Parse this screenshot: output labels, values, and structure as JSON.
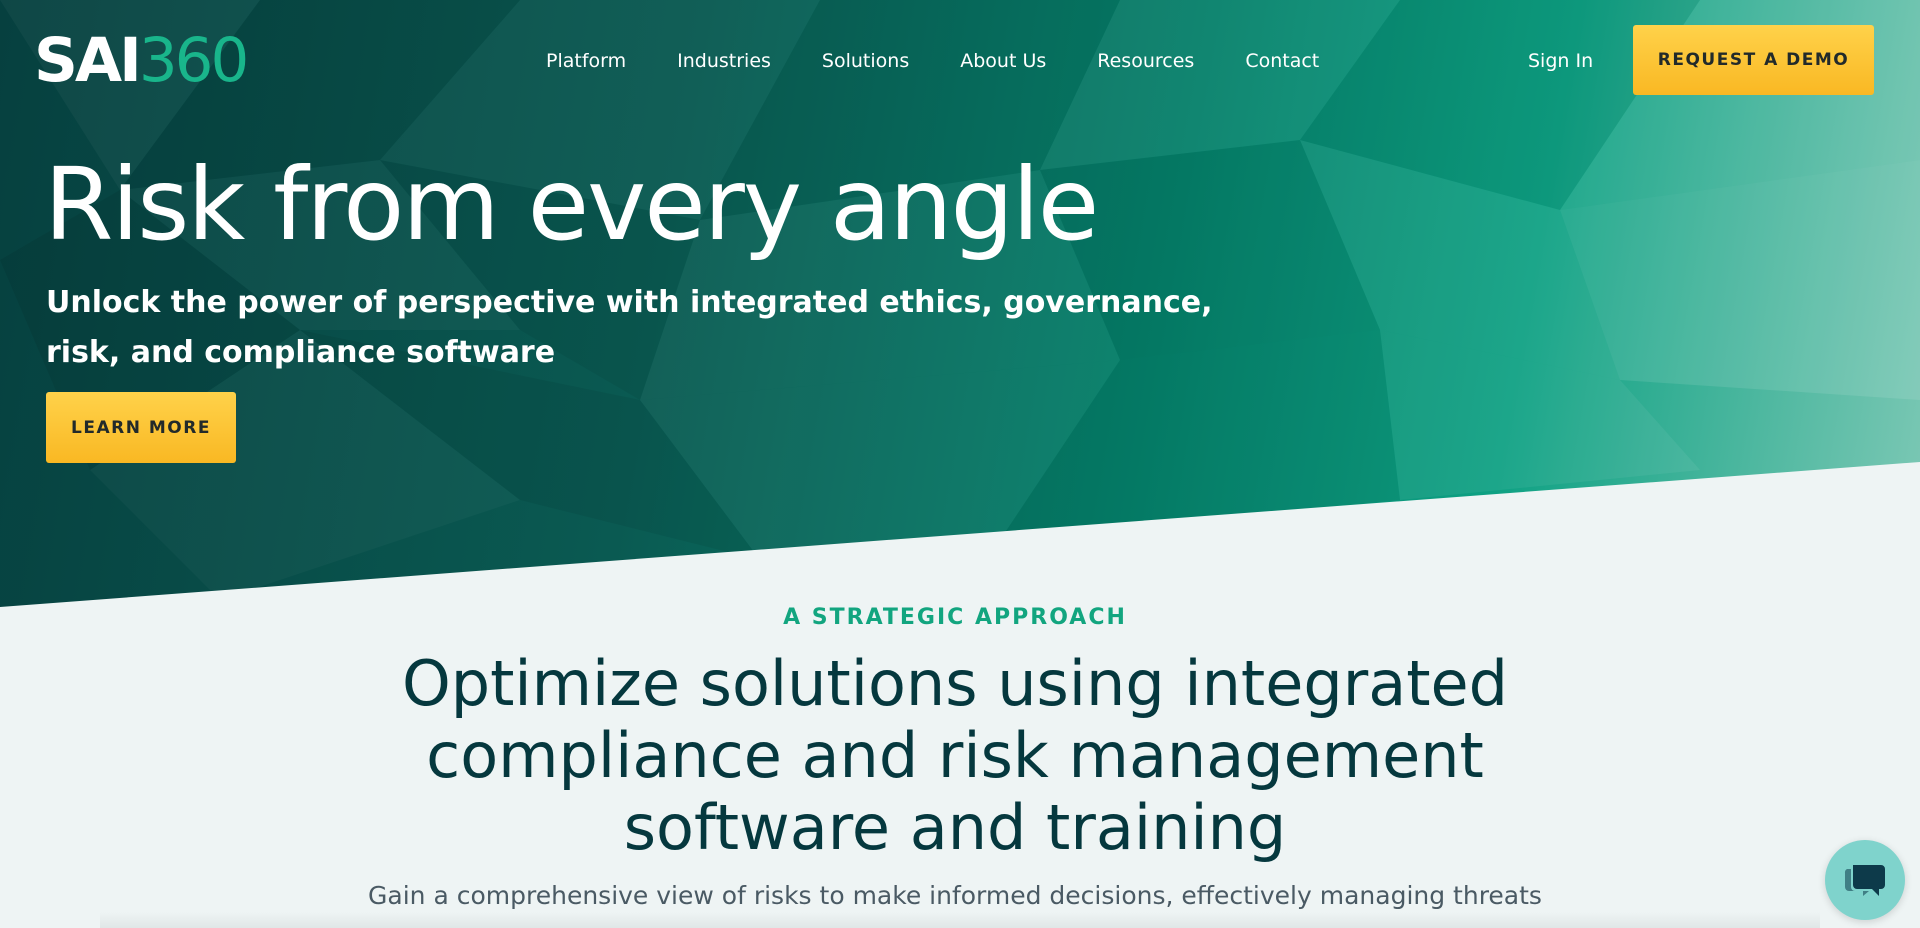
{
  "logo": {
    "prefix": "SAI",
    "suffix": "360"
  },
  "nav": {
    "items": [
      {
        "label": "Platform"
      },
      {
        "label": "Industries"
      },
      {
        "label": "Solutions"
      },
      {
        "label": "About Us"
      },
      {
        "label": "Resources"
      },
      {
        "label": "Contact"
      }
    ],
    "sign_in": "Sign In",
    "demo_button": "REQUEST A DEMO"
  },
  "hero": {
    "title": "Risk from every angle",
    "subtitle": "Unlock the power of perspective with integrated ethics, governance, risk, and compliance software",
    "cta": "LEARN MORE"
  },
  "strategic": {
    "eyebrow": "A STRATEGIC APPROACH",
    "title": "Optimize solutions using integrated compliance and risk management software and training",
    "body": "Gain a comprehensive view of risks to make informed decisions, effectively managing threats"
  },
  "colors": {
    "accent_green": "#12a57f",
    "cta_yellow": "#f9b823",
    "heading_dark": "#05383e",
    "chat_teal": "#7fd3cc"
  },
  "icons": {
    "chat": "chat-bubble-icon"
  }
}
